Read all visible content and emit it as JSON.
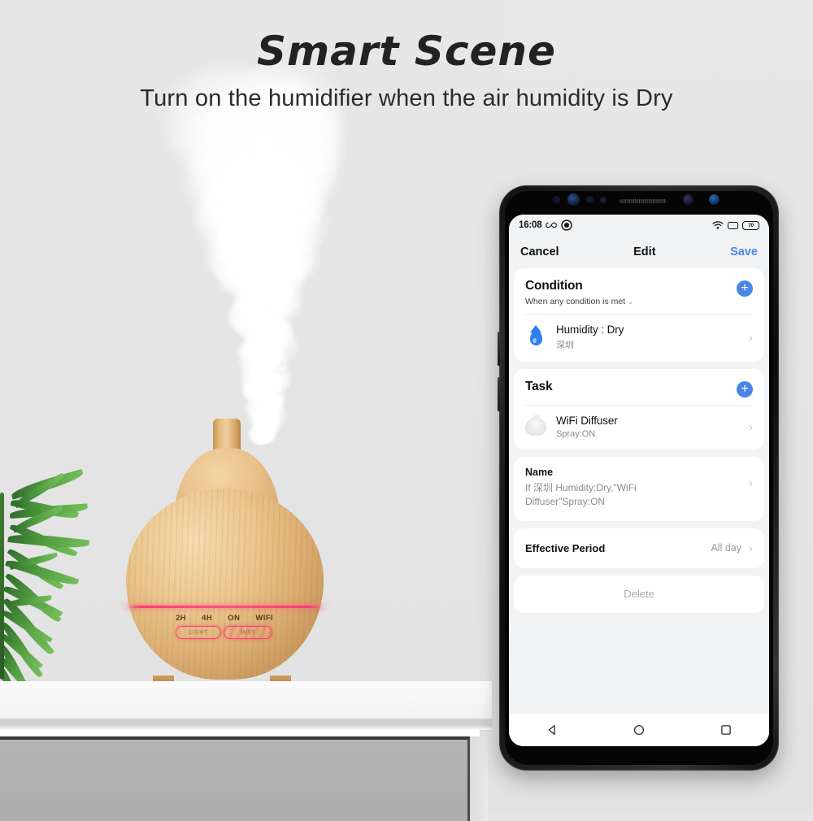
{
  "banner": {
    "title": "Smart Scene",
    "subtitle": "Turn on the humidifier when the air humidity is Dry"
  },
  "product": {
    "panel_labels": [
      "2H",
      "4H",
      "ON",
      "WIFI"
    ],
    "buttons": {
      "light": "LIGHT",
      "mist": "MIST"
    }
  },
  "phone": {
    "statusbar": {
      "time": "16:08",
      "left_icons": [
        "infinity-icon",
        "alarm-icon"
      ],
      "right_icons": [
        "wifi-icon",
        "sim-icon"
      ],
      "battery_level": "70"
    },
    "appbar": {
      "cancel": "Cancel",
      "title": "Edit",
      "save": "Save"
    },
    "condition": {
      "title": "Condition",
      "mode": "When any condition is met",
      "add_label": "+",
      "items": [
        {
          "icon": "humidity-droplet-icon",
          "title": "Humidity : Dry",
          "subtitle": "深圳",
          "chevron": "›"
        }
      ]
    },
    "task": {
      "title": "Task",
      "add_label": "+",
      "items": [
        {
          "icon": "diffuser-thumbnail-icon",
          "title": "WiFi Diffuser",
          "subtitle": "Spray:ON",
          "chevron": "›"
        }
      ]
    },
    "name": {
      "label": "Name",
      "value": "If 深圳 Humidity:Dry,\"WiFi Diffuser\"Spray:ON",
      "chevron": "›"
    },
    "effective_period": {
      "label": "Effective Period",
      "value": "All day",
      "chevron": "›"
    },
    "delete": {
      "label": "Delete"
    },
    "androidnav": [
      "back-icon",
      "home-icon",
      "recents-icon"
    ]
  },
  "colors": {
    "accent_blue": "#4a86e8",
    "led_pink": "#ff3c78",
    "page_bg": "#e6e6e6",
    "screen_bg": "#f2f3f5",
    "card_bg": "#ffffff"
  }
}
